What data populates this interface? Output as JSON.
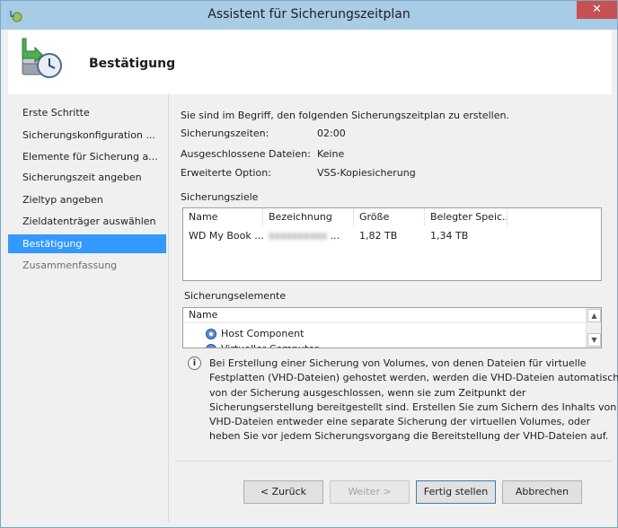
{
  "window": {
    "title": "Assistent für Sicherungszeitplan",
    "close_label": "✕"
  },
  "header": {
    "title": "Bestätigung"
  },
  "nav": {
    "items": [
      {
        "label": "Erste Schritte",
        "state": "normal"
      },
      {
        "label": "Sicherungskonfiguration ...",
        "state": "normal"
      },
      {
        "label": "Elemente für Sicherung a...",
        "state": "normal"
      },
      {
        "label": "Sicherungszeit angeben",
        "state": "normal"
      },
      {
        "label": "Zieltyp angeben",
        "state": "normal"
      },
      {
        "label": "Zieldatenträger auswählen",
        "state": "normal"
      },
      {
        "label": "Bestätigung",
        "state": "active"
      },
      {
        "label": "Zusammenfassung",
        "state": "disabled"
      }
    ]
  },
  "main": {
    "intro": "Sie sind im Begriff, den folgenden Sicherungszeitplan zu erstellen.",
    "fields": [
      {
        "label": "Sicherungszeiten:",
        "value": "02:00"
      },
      {
        "label": "Ausgeschlossene Dateien:",
        "value": "Keine"
      },
      {
        "label": "Erweiterte Option:",
        "value": "VSS-Kopiesicherung"
      }
    ],
    "targets": {
      "heading": "Sicherungsziele",
      "columns": [
        "Name",
        "Bezeichnung",
        "Größe",
        "Belegter Speic..."
      ],
      "rows": [
        {
          "name": "WD My Book ...",
          "label": "...",
          "size": "1,82 TB",
          "used": "1,34 TB"
        }
      ]
    },
    "elements": {
      "heading": "Sicherungselemente",
      "column": "Name",
      "items": [
        "Host Component",
        "Virtueller Computer"
      ]
    },
    "info": "Bei Erstellung einer Sicherung von Volumes, von denen Dateien für virtuelle Festplatten (VHD-Dateien) gehostet werden, werden die VHD-Dateien automatisch von der Sicherung ausgeschlossen, wenn sie zum Zeitpunkt der Sicherungserstellung bereitgestellt sind. Erstellen Sie zum Sichern des Inhalts von VHD-Dateien entweder eine separate Sicherung der virtuellen Volumes, oder heben Sie vor jedem Sicherungsvorgang die Bereitstellung der VHD-Dateien auf."
  },
  "buttons": {
    "back": "< Zurück",
    "next": "Weiter >",
    "finish": "Fertig stellen",
    "cancel": "Abbrechen"
  },
  "colors": {
    "accent": "#3399ff",
    "titlebar": "#a8cbe6",
    "close": "#c75050"
  }
}
